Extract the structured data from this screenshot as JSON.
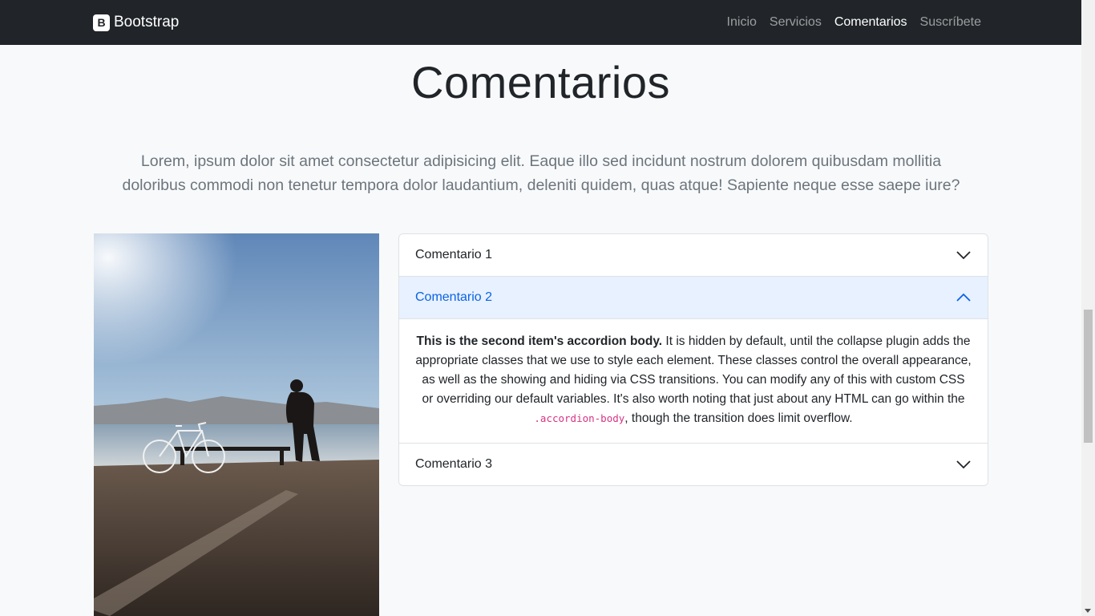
{
  "navbar": {
    "brand_logo": "B",
    "brand_text": "Bootstrap",
    "links": [
      {
        "label": "Inicio",
        "active": false
      },
      {
        "label": "Servicios",
        "active": false
      },
      {
        "label": "Comentarios",
        "active": true
      },
      {
        "label": "Suscríbete",
        "active": false
      }
    ]
  },
  "section": {
    "title": "Comentarios",
    "lead": "Lorem, ipsum dolor sit amet consectetur adipisicing elit. Eaque illo sed incidunt nostrum dolorem quibusdam mollitia doloribus commodi non tenetur tempora dolor laudantium, deleniti quidem, quas atque! Sapiente neque esse saepe iure?"
  },
  "accordion": {
    "items": [
      {
        "label": "Comentario 1",
        "expanded": false
      },
      {
        "label": "Comentario 2",
        "expanded": true
      },
      {
        "label": "Comentario 3",
        "expanded": false
      }
    ],
    "body": {
      "strong": "This is the second item's accordion body.",
      "text1": " It is hidden by default, until the collapse plugin adds the appropriate classes that we use to style each element. These classes control the overall appearance, as well as the showing and hiding via CSS transitions. You can modify any of this with custom CSS or overriding our default variables. It's also worth noting that just about any HTML can go within the ",
      "code": ".accordion-body",
      "text2": ", though the transition does limit overflow."
    }
  },
  "colors": {
    "navbar_bg": "#212529",
    "accent": "#0c63e4",
    "open_header_bg": "#e7f1ff"
  },
  "icons": {
    "collapsed": "chevron-down-icon",
    "expanded": "chevron-up-icon"
  }
}
